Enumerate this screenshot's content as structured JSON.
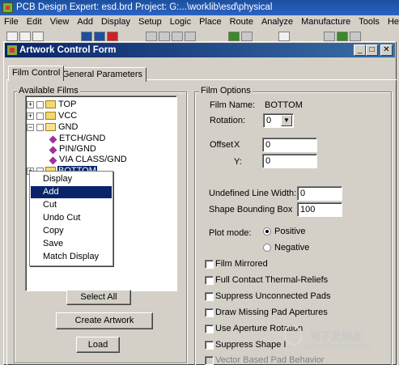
{
  "app": {
    "title": "PCB Design Expert: esd.brd  Project: G:...\\worklib\\esd\\physical",
    "menu": [
      "File",
      "Edit",
      "View",
      "Add",
      "Display",
      "Setup",
      "Logic",
      "Place",
      "Route",
      "Analyze",
      "Manufacture",
      "Tools",
      "Help"
    ]
  },
  "dialog": {
    "title": "Artwork Control Form",
    "tabs": [
      "Film Control",
      "General Parameters"
    ],
    "active_tab": "Film Control"
  },
  "available_films": {
    "label": "Available Films",
    "nodes": [
      {
        "label": "TOP",
        "expander": "+"
      },
      {
        "label": "VCC",
        "expander": "+"
      },
      {
        "label": "GND",
        "expander": "−"
      },
      {
        "label": "ETCH/GND"
      },
      {
        "label": "PIN/GND"
      },
      {
        "label": "VIA CLASS/GND"
      },
      {
        "label": "BOTTOM",
        "expander": "+",
        "selected": true
      }
    ],
    "context_menu": [
      {
        "label": "Display"
      },
      {
        "label": "Add",
        "highlighted": true
      },
      {
        "label": "Cut"
      },
      {
        "label": "Undo Cut"
      },
      {
        "label": "Copy"
      },
      {
        "label": "Save"
      },
      {
        "label": "Match Display"
      }
    ],
    "buttons": {
      "select_all": "Select All",
      "create_artwork": "Create Artwork",
      "load": "Load"
    }
  },
  "film_options": {
    "label": "Film Options",
    "film_name_label": "Film Name:",
    "film_name_value": "BOTTOM",
    "rotation_label": "Rotation:",
    "rotation_value": "0",
    "offset_label": "Offset",
    "offset_x_label": "X",
    "offset_x_value": "0",
    "offset_y_label": "Y:",
    "offset_y_value": "0",
    "undefined_line_width_label": "Undefined Line Width:",
    "undefined_line_width_value": "0",
    "shape_bounding_box_label": "Shape Bounding Box",
    "shape_bounding_box_value": "100",
    "plot_mode_label": "Plot mode:",
    "plot_mode_options": [
      "Positive",
      "Negative"
    ],
    "plot_mode_selected": "Positive",
    "checkboxes": [
      {
        "label": "Film Mirrored",
        "checked": false,
        "disabled": false
      },
      {
        "label": "Full Contact Thermal-Reliefs",
        "checked": false,
        "disabled": false
      },
      {
        "label": "Suppress Unconnected Pads",
        "checked": false,
        "disabled": false
      },
      {
        "label": "Draw Missing Pad Apertures",
        "checked": false,
        "disabled": false
      },
      {
        "label": "Use Aperture Rotation",
        "checked": false,
        "disabled": false
      },
      {
        "label": "Suppress Shape I",
        "checked": false,
        "disabled": false
      },
      {
        "label": "Vector Based Pad Behavior",
        "checked": false,
        "disabled": true
      }
    ]
  },
  "watermark": {
    "line1": "电子发烧友",
    "line2": "www.elecfans.com"
  },
  "colors": {
    "titlebar": "#0a246a",
    "selection": "#0a246a",
    "face": "#d4d0c8"
  }
}
